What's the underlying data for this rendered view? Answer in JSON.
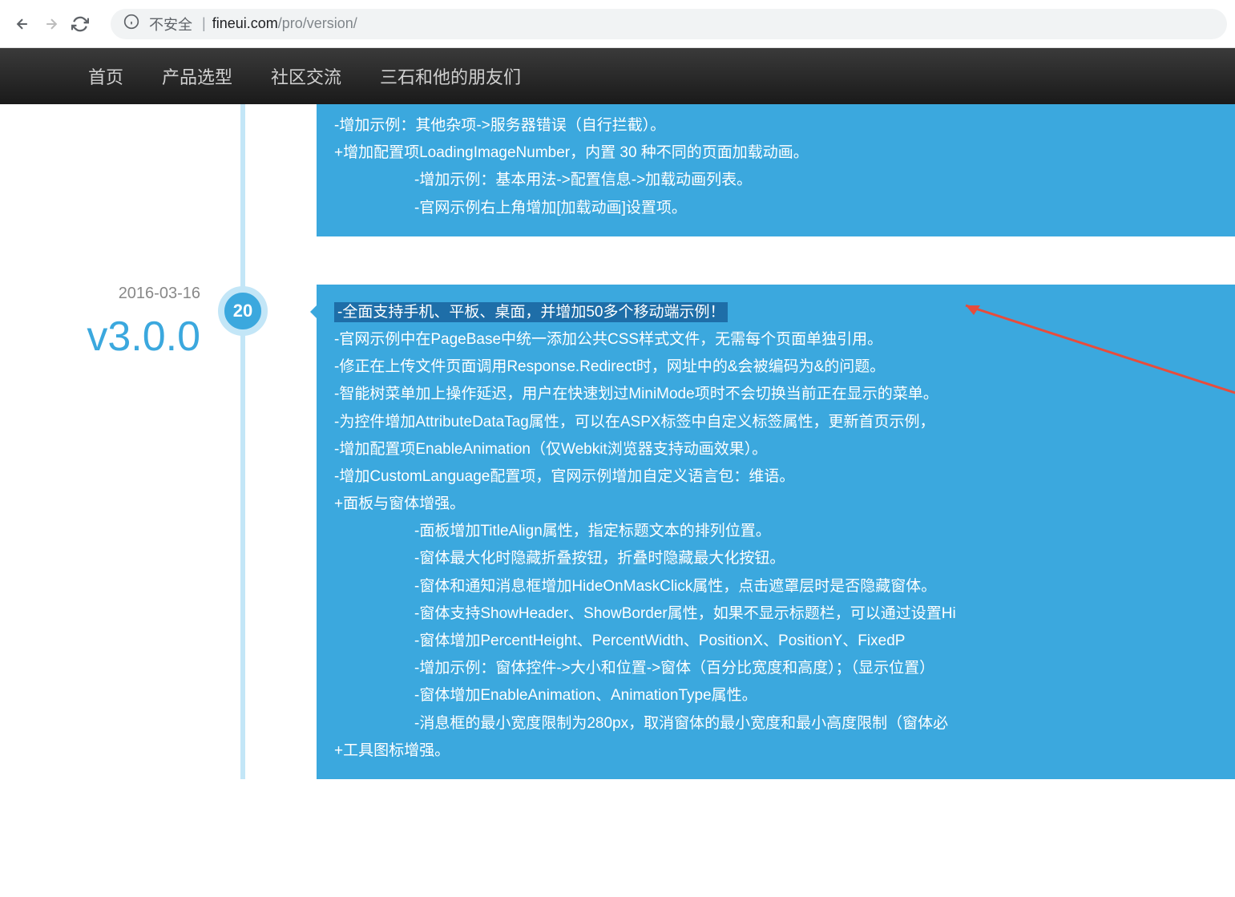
{
  "browser": {
    "security_label": "不安全",
    "url_host": "fineui.com",
    "url_path": "/pro/version/"
  },
  "nav": {
    "items": [
      "首页",
      "产品选型",
      "社区交流",
      "三石和他的朋友们"
    ]
  },
  "timeline": {
    "prev_block": {
      "lines": [
        {
          "text": "-增加示例：其他杂项->服务器错误（自行拦截）。",
          "indent": 1
        },
        {
          "text": "+增加配置项LoadingImageNumber，内置 30 种不同的页面加载动画。",
          "indent": 0
        },
        {
          "text": "-增加示例：基本用法->配置信息->加载动画列表。",
          "indent": 2
        },
        {
          "text": "-官网示例右上角增加[加载动画]设置项。",
          "indent": 2
        }
      ]
    },
    "entry": {
      "date": "2016-03-16",
      "version": "v3.0.0",
      "day": "20",
      "lines": [
        {
          "text": "-全面支持手机、平板、桌面，并增加50多个移动端示例！",
          "indent": 0,
          "highlighted": true
        },
        {
          "text": "-官网示例中在PageBase中统一添加公共CSS样式文件，无需每个页面单独引用。",
          "indent": 0
        },
        {
          "text": "-修正在上传文件页面调用Response.Redirect时，网址中的&会被编码为&的问题。",
          "indent": 0
        },
        {
          "text": "-智能树菜单加上操作延迟，用户在快速划过MiniMode项时不会切换当前正在显示的菜单。",
          "indent": 0
        },
        {
          "text": "-为控件增加AttributeDataTag属性，可以在ASPX标签中自定义标签属性，更新首页示例，",
          "indent": 0
        },
        {
          "text": "-增加配置项EnableAnimation（仅Webkit浏览器支持动画效果）。",
          "indent": 0
        },
        {
          "text": "-增加CustomLanguage配置项，官网示例增加自定义语言包：维语。",
          "indent": 0
        },
        {
          "text": "+面板与窗体增强。",
          "indent": 0
        },
        {
          "text": "-面板增加TitleAlign属性，指定标题文本的排列位置。",
          "indent": 2
        },
        {
          "text": "-窗体最大化时隐藏折叠按钮，折叠时隐藏最大化按钮。",
          "indent": 2
        },
        {
          "text": "-窗体和通知消息框增加HideOnMaskClick属性，点击遮罩层时是否隐藏窗体。",
          "indent": 2
        },
        {
          "text": "-窗体支持ShowHeader、ShowBorder属性，如果不显示标题栏，可以通过设置Hi",
          "indent": 2
        },
        {
          "text": "-窗体增加PercentHeight、PercentWidth、PositionX、PositionY、FixedP",
          "indent": 2
        },
        {
          "text": "-增加示例：窗体控件->大小和位置->窗体（百分比宽度和高度）；（显示位置）",
          "indent": 2
        },
        {
          "text": "-窗体增加EnableAnimation、AnimationType属性。",
          "indent": 2
        },
        {
          "text": "-消息框的最小宽度限制为280px，取消窗体的最小宽度和最小高度限制（窗体必",
          "indent": 2
        },
        {
          "text": "+工具图标增强。",
          "indent": 0
        }
      ]
    }
  }
}
